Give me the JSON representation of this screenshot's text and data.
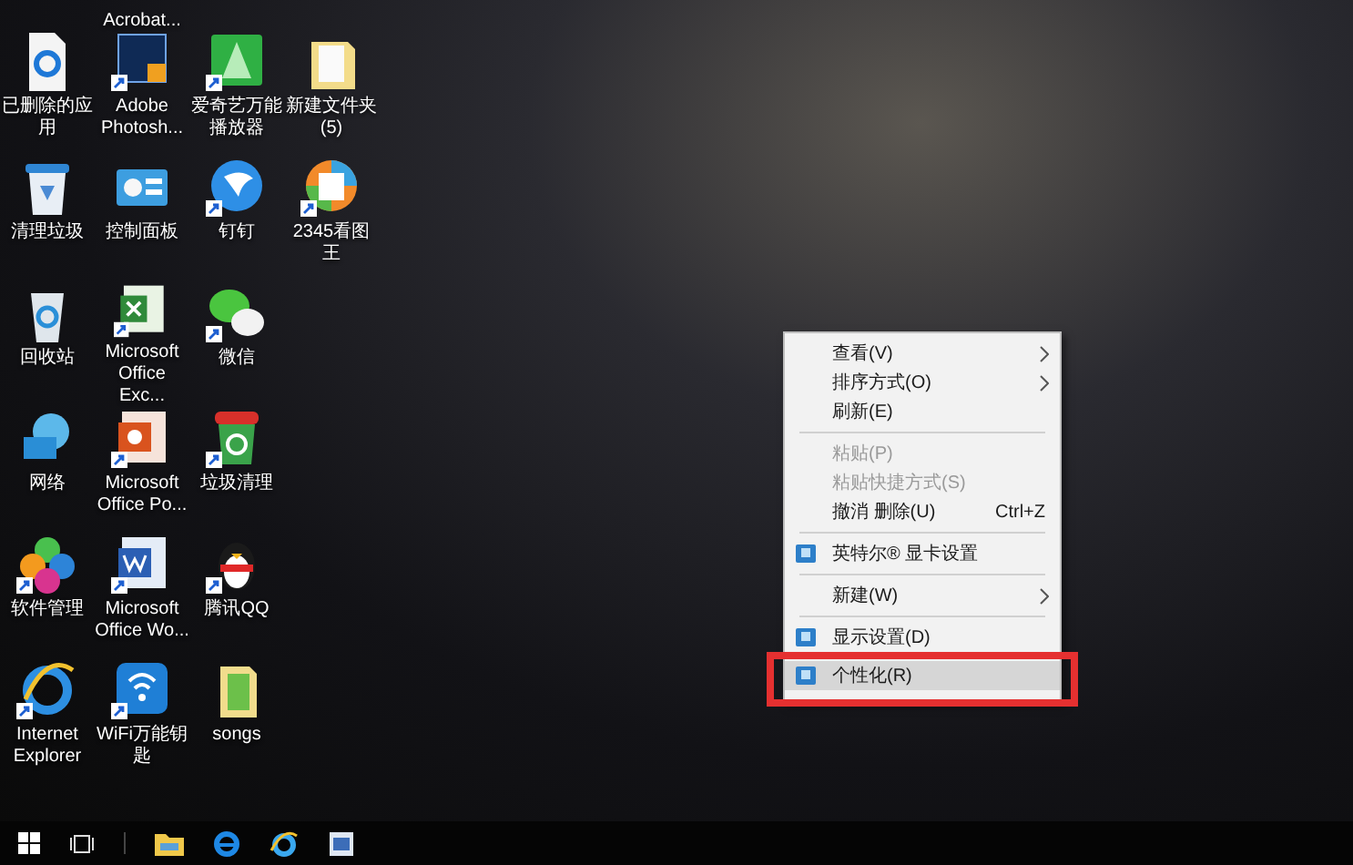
{
  "desktop": {
    "columns": [
      {
        "items": [
          {
            "label": "已删除的应用",
            "shortcut": false
          },
          {
            "label": "清理垃圾",
            "shortcut": false
          },
          {
            "label": "回收站",
            "shortcut": false
          },
          {
            "label": "网络",
            "shortcut": false
          },
          {
            "label": "软件管理",
            "shortcut": true
          },
          {
            "label": "Internet Explorer",
            "shortcut": true
          }
        ]
      },
      {
        "cut_label": "Acrobat...",
        "items": [
          {
            "label": "Adobe Photosh...",
            "shortcut": true
          },
          {
            "label": "控制面板",
            "shortcut": false
          },
          {
            "label": "Microsoft Office Exc...",
            "shortcut": true
          },
          {
            "label": "Microsoft Office Po...",
            "shortcut": true
          },
          {
            "label": "Microsoft Office Wo...",
            "shortcut": true
          },
          {
            "label": "WiFi万能钥匙",
            "shortcut": true
          }
        ]
      },
      {
        "items": [
          {
            "label": "爱奇艺万能播放器",
            "shortcut": true
          },
          {
            "label": "钉钉",
            "shortcut": true
          },
          {
            "label": "微信",
            "shortcut": true
          },
          {
            "label": "垃圾清理",
            "shortcut": true
          },
          {
            "label": "腾讯QQ",
            "shortcut": true
          },
          {
            "label": "songs",
            "shortcut": false
          }
        ]
      },
      {
        "items": [
          {
            "label": "新建文件夹 (5)",
            "shortcut": false
          },
          {
            "label": "2345看图王",
            "shortcut": true
          }
        ]
      }
    ]
  },
  "context_menu": {
    "items": [
      {
        "kind": "item",
        "label": "查看(V)",
        "submenu": true,
        "disabled": false,
        "icon": false,
        "selected": false,
        "annotated": false
      },
      {
        "kind": "item",
        "label": "排序方式(O)",
        "submenu": true,
        "disabled": false,
        "icon": false,
        "selected": false,
        "annotated": false
      },
      {
        "kind": "item",
        "label": "刷新(E)",
        "submenu": false,
        "disabled": false,
        "icon": false,
        "selected": false,
        "annotated": false
      },
      {
        "kind": "separator"
      },
      {
        "kind": "item",
        "label": "粘贴(P)",
        "submenu": false,
        "disabled": true,
        "icon": false,
        "selected": false,
        "annotated": false
      },
      {
        "kind": "item",
        "label": "粘贴快捷方式(S)",
        "submenu": false,
        "disabled": true,
        "icon": false,
        "selected": false,
        "annotated": false
      },
      {
        "kind": "item",
        "label": "撤消 删除(U)",
        "accelerator": "Ctrl+Z",
        "submenu": false,
        "disabled": false,
        "icon": false,
        "selected": false,
        "annotated": false
      },
      {
        "kind": "separator"
      },
      {
        "kind": "item",
        "label": "英特尔® 显卡设置",
        "submenu": false,
        "disabled": false,
        "icon": true,
        "selected": false,
        "annotated": false
      },
      {
        "kind": "separator"
      },
      {
        "kind": "item",
        "label": "新建(W)",
        "submenu": true,
        "disabled": false,
        "icon": false,
        "selected": false,
        "annotated": false
      },
      {
        "kind": "separator"
      },
      {
        "kind": "item",
        "label": "显示设置(D)",
        "submenu": false,
        "disabled": false,
        "icon": true,
        "selected": false,
        "annotated": false
      },
      {
        "kind": "item",
        "label": "个性化(R)",
        "submenu": false,
        "disabled": false,
        "icon": true,
        "selected": true,
        "annotated": true
      }
    ]
  }
}
